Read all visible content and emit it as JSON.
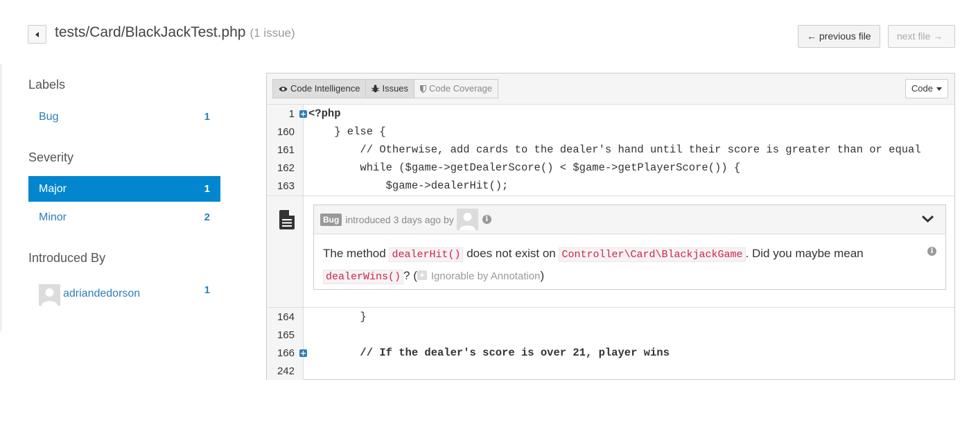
{
  "header": {
    "file_path": "tests/Card/BlackJackTest.php",
    "issue_count": "(1 issue)",
    "prev_file": "← previous file",
    "next_file": "next file →"
  },
  "sidebar": {
    "labels_heading": "Labels",
    "labels": [
      {
        "name": "Bug",
        "count": "1"
      }
    ],
    "severity_heading": "Severity",
    "severity": [
      {
        "name": "Major",
        "count": "1",
        "active": true
      },
      {
        "name": "Minor",
        "count": "2",
        "active": false
      }
    ],
    "introduced_heading": "Introduced By",
    "authors": [
      {
        "name": "adriandedorson",
        "count": "1"
      }
    ]
  },
  "toolbar": {
    "code_intelligence": "Code Intelligence",
    "issues": "Issues",
    "code_coverage": "Code Coverage",
    "view_select": "Code"
  },
  "code_top": [
    {
      "ln": "1",
      "expand": true,
      "src": "<?php",
      "bold": true
    },
    {
      "ln": "160",
      "expand": false,
      "src": "    } else {",
      "bold": false
    },
    {
      "ln": "161",
      "expand": false,
      "src": "        // Otherwise, add cards to the dealer's hand until their score is greater than or equal",
      "bold": false
    },
    {
      "ln": "162",
      "expand": false,
      "src": "        while ($game->getDealerScore() < $game->getPlayerScore()) {",
      "bold": false
    },
    {
      "ln": "163",
      "expand": false,
      "src": "            $game->dealerHit();",
      "bold": false
    }
  ],
  "issue": {
    "label": "Bug",
    "meta": "introduced 3 days ago by",
    "text_before": "The method ",
    "code1": "dealerHit()",
    "text_mid": " does not exist on ",
    "code2": "Controller\\Card\\BlackjackGame",
    "text_after": ". Did you maybe mean",
    "code3": "dealerWins()",
    "text_q": "? (",
    "annotation": "Ignorable by Annotation",
    "text_close": ")"
  },
  "code_bottom": [
    {
      "ln": "164",
      "expand": false,
      "src": "        }",
      "bold": false
    },
    {
      "ln": "165",
      "expand": false,
      "src": "",
      "bold": false
    },
    {
      "ln": "166",
      "expand": true,
      "src": "        // If the dealer's score is over 21, player wins",
      "bold": true
    },
    {
      "ln": "242",
      "expand": false,
      "src": "",
      "bold": false
    }
  ],
  "colors": {
    "accent": "#0286cf",
    "link": "#2c7fb8",
    "code_red": "#c7254e"
  }
}
